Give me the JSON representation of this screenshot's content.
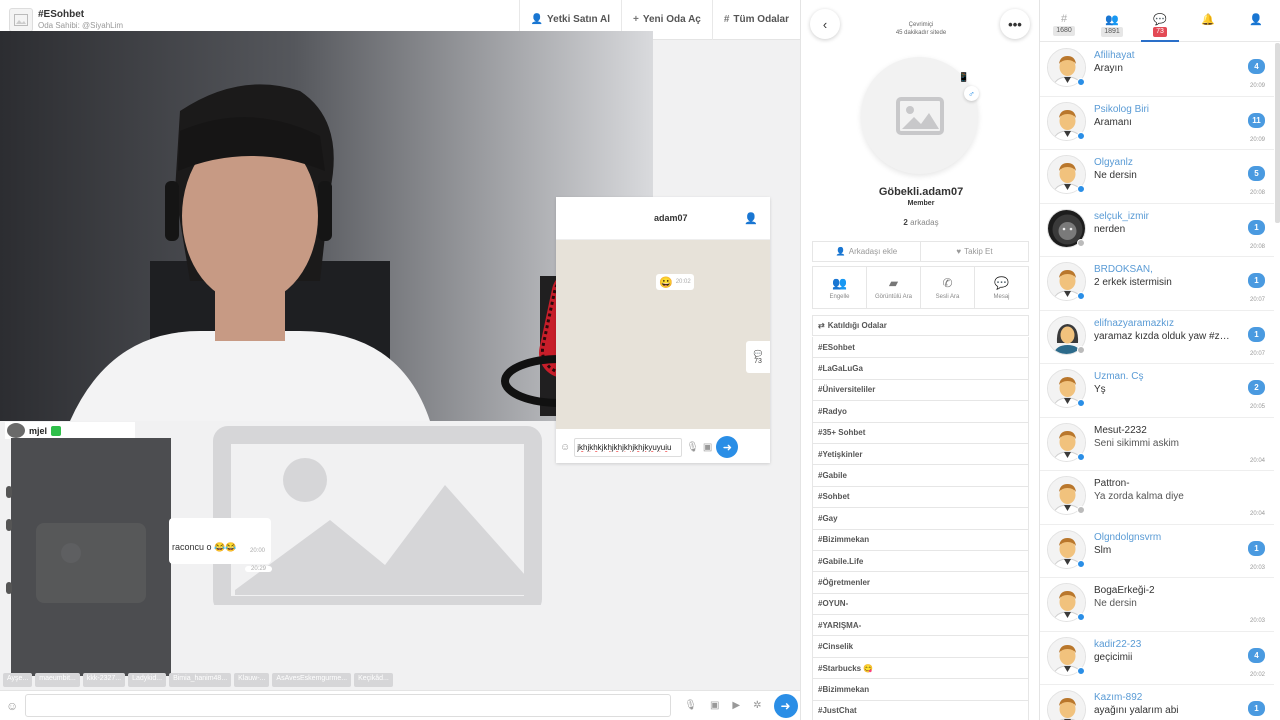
{
  "chat": {
    "room_title": "#ESohbet",
    "room_owner": "Oda Sahibi: @SiyahLim",
    "header_actions": [
      {
        "label": "Yetki Satın Al",
        "icon": "user-key-icon"
      },
      {
        "label": "Yeni Oda Aç",
        "icon": "plus-icon"
      },
      {
        "label": "Tüm Odalar",
        "icon": "hash-icon"
      }
    ],
    "private_chat": {
      "name": "adam07",
      "bubble_time": "20:02",
      "count": "73",
      "input_value": "jkhjkhkjkhjkhjkhjkhjkyuyuiu"
    },
    "message_tag": {
      "name": "mjel"
    },
    "message": {
      "text": "raconcu o 😂😂",
      "time": "20:00",
      "time2": "20:29"
    },
    "users_bar": [
      "Ayşe...",
      "maeumbit...",
      "kkk-2327...",
      "Ladykid...",
      "Bimia_hanim48...",
      "Klauw-...",
      "AsAvesEskemgurme...",
      "Keçikâd..."
    ],
    "input_placeholder": ""
  },
  "profile": {
    "status_online": "Çevrimiçi",
    "status_time": "45 dakikadır sitede",
    "name": "Göbekli.adam07",
    "role": "Member",
    "friends_count": "2",
    "friends_label": "arkadaş",
    "add_friend": "Arkadaşı ekle",
    "follow": "Takip Et",
    "actions": [
      {
        "label": "Engelle",
        "icon": "block-user-icon"
      },
      {
        "label": "Görüntülü Ara",
        "icon": "video-camera-icon"
      },
      {
        "label": "Sesli Ara",
        "icon": "phone-icon"
      },
      {
        "label": "Mesaj",
        "icon": "message-icon"
      }
    ],
    "rooms_header": "Katıldığı Odalar",
    "rooms": [
      "#ESohbet",
      "#LaGaLuGa",
      "#Üniversiteliler",
      "#Radyo",
      "#35+ Sohbet",
      "#Yetişkinler",
      "#Gabile",
      "#Sohbet",
      "#Gay",
      "#Bizimmekan",
      "#Gabile.Life",
      "#Öğretmenler",
      "#OYUN-",
      "#YARIŞMA-",
      "#Cinselik",
      "#Starbucks 😋",
      "#Bizimmekan",
      "#JustChat"
    ]
  },
  "tabs": [
    {
      "icon": "hash-icon",
      "count": "1680"
    },
    {
      "icon": "users-icon",
      "count": "1891"
    },
    {
      "icon": "chat-icon",
      "count": "73",
      "active": true
    },
    {
      "icon": "bell-icon",
      "count": ""
    },
    {
      "icon": "user-icon",
      "count": ""
    }
  ],
  "conversations": [
    {
      "name": "Afilihayat",
      "message": "Arayın",
      "badge": "4",
      "time": "20:09",
      "avatar": "default-man",
      "online": true
    },
    {
      "name": "Psikolog Biri",
      "message": "Aramanı",
      "badge": "11",
      "time": "20:09",
      "avatar": "default-man",
      "online": true
    },
    {
      "name": "Olgyanlz",
      "message": "Ne dersin",
      "badge": "5",
      "time": "20:08",
      "avatar": "default-man",
      "online": true
    },
    {
      "name": "selçuk_izmir",
      "message": "nerden",
      "badge": "1",
      "time": "20:08",
      "avatar": "lion",
      "online": false
    },
    {
      "name": "BRDOKSAN,",
      "message": "2 erkek istermisin",
      "badge": "1",
      "time": "20:07",
      "avatar": "default-man",
      "online": true
    },
    {
      "name": "elifnazyaramazkız",
      "message": "yaramaz kızda olduk yaw #zen…",
      "badge": "1",
      "time": "20:07",
      "avatar": "default-woman",
      "online": false
    },
    {
      "name": "Uzman. Cş",
      "message": "Yş",
      "badge": "2",
      "time": "20:05",
      "avatar": "default-man",
      "online": true
    },
    {
      "name": "Mesut-2232",
      "message": "Seni sikimmi askim",
      "badge": "",
      "time": "20:04",
      "avatar": "default-man",
      "online": true
    },
    {
      "name": "Pattron-",
      "message": "Ya zorda kalma diye",
      "badge": "",
      "time": "20:04",
      "avatar": "default-man",
      "online": false
    },
    {
      "name": "Olgndolgnsvrm",
      "message": "Slm",
      "badge": "1",
      "time": "20:03",
      "avatar": "default-man",
      "online": true
    },
    {
      "name": "BogaErkeği-2",
      "message": "Ne dersin",
      "badge": "",
      "time": "20:03",
      "avatar": "default-man",
      "online": true
    },
    {
      "name": "kadir22-23",
      "message": "geçicimii",
      "badge": "4",
      "time": "20:02",
      "avatar": "default-man",
      "online": true
    },
    {
      "name": "Kazım-892",
      "message": "ayağını yalarım abi",
      "badge": "1",
      "time": "",
      "avatar": "default-man",
      "online": true
    }
  ],
  "colors": {
    "accent": "#2a8ee6",
    "badge": "#4a9ae0",
    "tab_red": "#e34a55"
  }
}
